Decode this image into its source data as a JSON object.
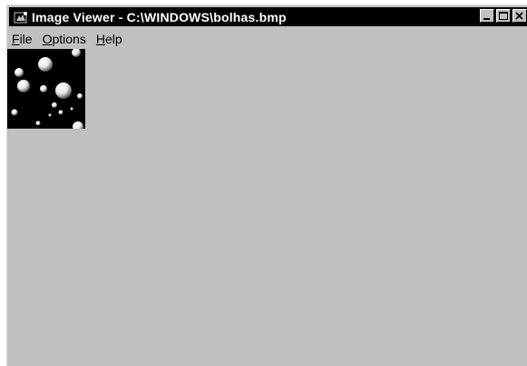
{
  "window": {
    "title": "Image Viewer - C:\\WINDOWS\\bolhas.bmp",
    "icon": "image-viewer-app-icon",
    "controls": [
      "minimize-icon",
      "maximize-icon",
      "close-icon"
    ]
  },
  "menu": {
    "items": [
      {
        "label": "File",
        "accel": "F",
        "rest": "ile"
      },
      {
        "label": "Options",
        "accel": "O",
        "rest": "ptions"
      },
      {
        "label": "Help",
        "accel": "H",
        "rest": "elp"
      }
    ]
  },
  "image": {
    "subject": "bubbles bitmap",
    "background_color": "#000000"
  },
  "colors": {
    "titlebar": "#000000",
    "window": "#c0c0c0",
    "title_text": "#ffffff"
  }
}
